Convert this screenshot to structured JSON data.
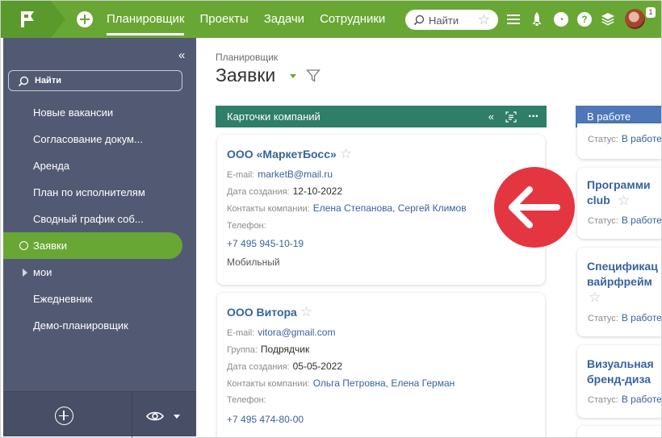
{
  "topbar": {
    "nav": [
      "Планировщик",
      "Проекты",
      "Задачи",
      "Сотрудники"
    ],
    "search_placeholder": "Найти",
    "notification_count": "1",
    "accent": "#69a734"
  },
  "sidebar": {
    "search_placeholder": "Найти",
    "items": [
      "Новые вакансии",
      "Согласование докум...",
      "Аренда",
      "План по исполнителям",
      "Сводный график соб...",
      "Заявки",
      "мои",
      "Ежедневник",
      "Демо-планировщик"
    ],
    "active_item": "Заявки"
  },
  "page": {
    "breadcrumb": "Планировщик",
    "title": "Заявки"
  },
  "columns": [
    {
      "title": "Карточки компаний",
      "color": "#2f7e67",
      "cards": [
        {
          "name": "ООО «МаркетБосс»",
          "email_label": "E-mail:",
          "email": "marketB@mail.ru",
          "date_label": "Дата создания:",
          "date": "12-10-2022",
          "contacts_label": "Контакты компании:",
          "contacts": "Елена Степанова, Сергей Климов",
          "phone_label": "Телефон:",
          "phone": "+7 495 945-10-19",
          "phone_type": "Мобильный"
        },
        {
          "name": "ООО Витора",
          "email_label": "E-mail:",
          "email": "vitora@gmail.com",
          "group_label": "Группа:",
          "group": "Подрядчик",
          "date_label": "Дата создания:",
          "date": "05-05-2022",
          "contacts_label": "Контакты компании:",
          "contacts": "Ольга Петровна, Елена Герман",
          "phone_label": "Телефон:",
          "phone": "+7 495 474-80-00"
        }
      ]
    },
    {
      "title": "В работе",
      "color": "#4d77b8",
      "cards": [
        {
          "status_label": "Статус:",
          "status": "В работе"
        },
        {
          "name_lines": [
            "Программи",
            "club"
          ],
          "status_label": "Статус:",
          "status": "В работе"
        },
        {
          "name_lines": [
            "Спецификац",
            "вайрфрейм"
          ],
          "status_label": "Статус:",
          "status": "В работе"
        },
        {
          "name_lines": [
            "Визуальная",
            "бренд-диза"
          ],
          "status_label": "Статус:",
          "status": "В работе"
        }
      ]
    }
  ],
  "overlay": {
    "icon": "arrow-left-icon",
    "color": "#e43641"
  }
}
